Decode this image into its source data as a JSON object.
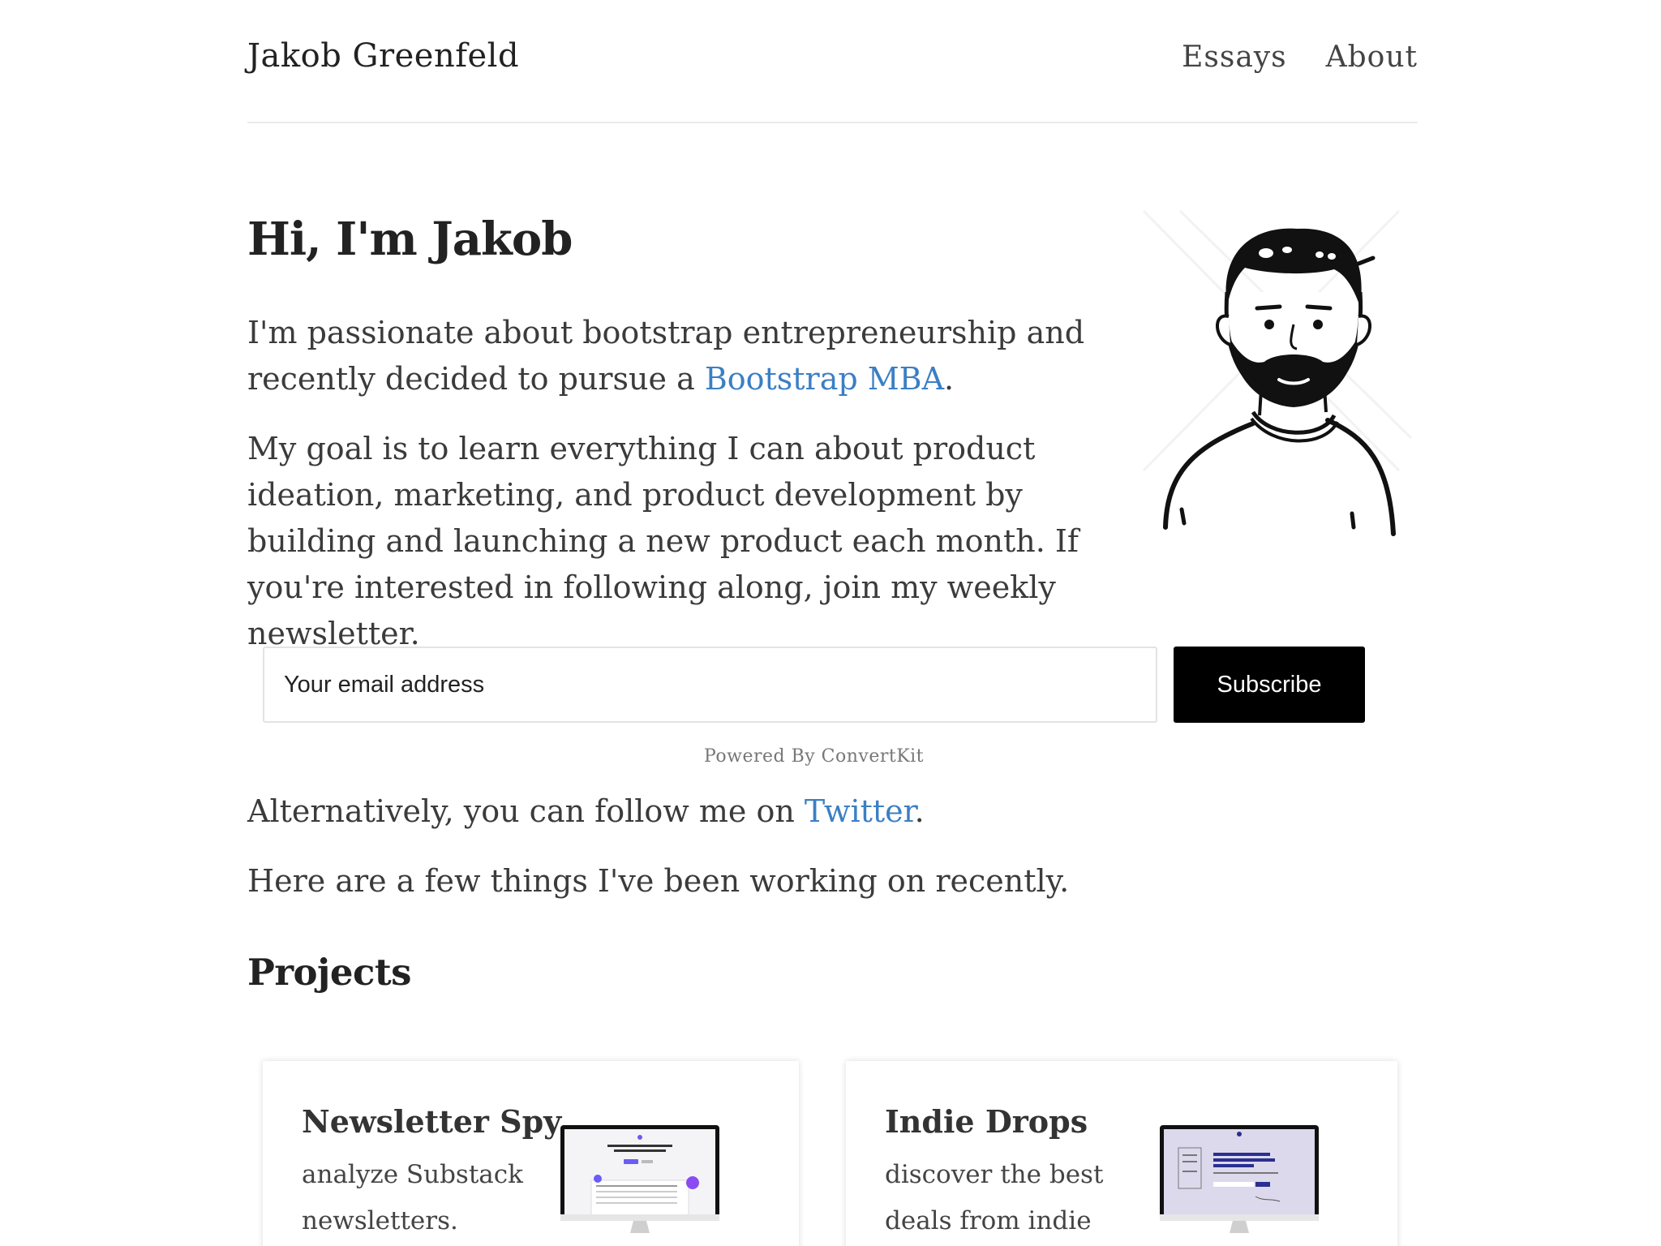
{
  "header": {
    "site_title": "Jakob Greenfeld",
    "nav": [
      {
        "label": "Essays"
      },
      {
        "label": "About"
      }
    ]
  },
  "hero": {
    "title": "Hi, I'm Jakob",
    "p1_text": "I'm passionate about bootstrap entrepreneurship and recently decided to pursue a ",
    "p1_link": "Bootstrap MBA",
    "p1_end": ".",
    "p2_text": "My goal is to learn everything I can about product ideation, marketing, and product development by building and launching a new product each month. If you're interested in following along, join my weekly newsletter."
  },
  "newsletter": {
    "email_placeholder": "Your email address",
    "subscribe_label": "Subscribe",
    "powered_by": "Powered By ConvertKit"
  },
  "follow": {
    "text": "Alternatively, you can follow me on ",
    "link": "Twitter",
    "end": "."
  },
  "recent": {
    "text": "Here are a few things I've been working on recently."
  },
  "projects": {
    "title": "Projects",
    "items": [
      {
        "name": "Newsletter Spy",
        "description": "analyze Substack newsletters."
      },
      {
        "name": "Indie Drops",
        "description": "discover the best deals from indie"
      }
    ]
  },
  "colors": {
    "link": "#3b7fc4",
    "button_bg": "#000000",
    "text": "#3b3b3b"
  }
}
